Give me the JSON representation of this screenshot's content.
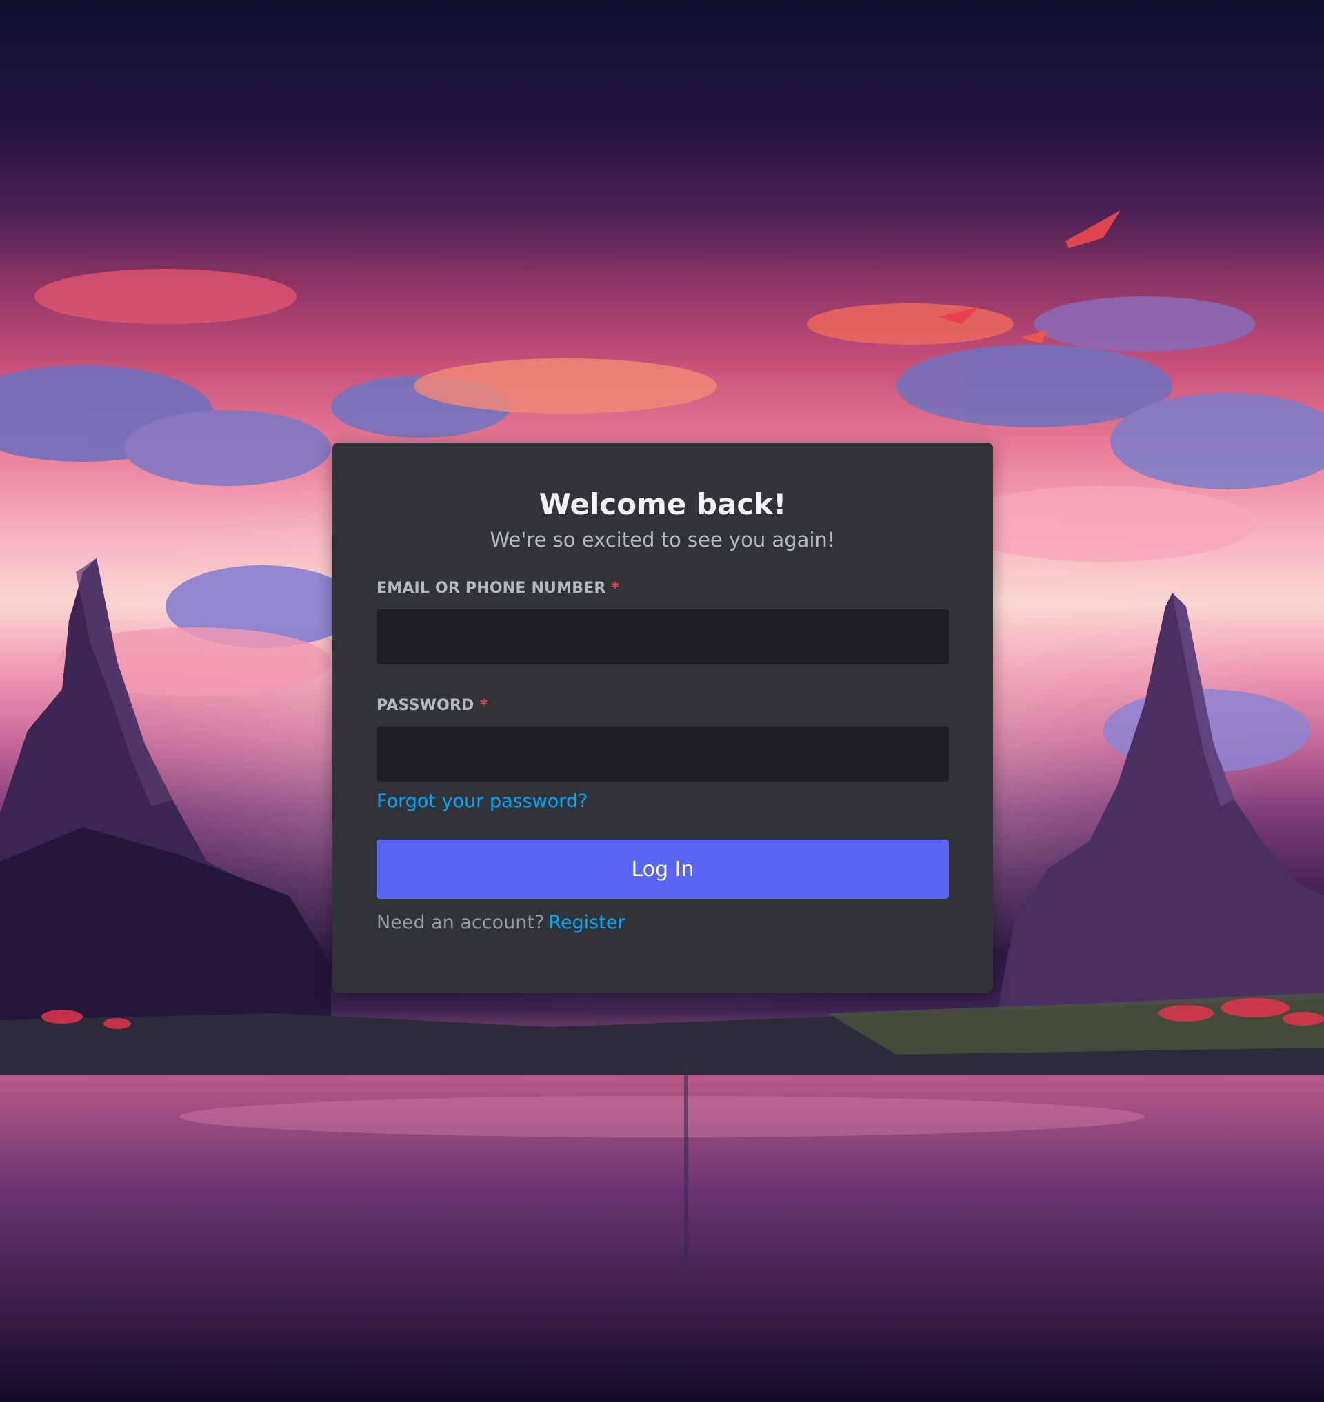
{
  "login": {
    "title": "Welcome back!",
    "subtitle": "We're so excited to see you again!",
    "email_label": "EMAIL OR PHONE NUMBER",
    "email_value": "",
    "password_label": "PASSWORD",
    "password_value": "",
    "required_marker": "*",
    "forgot_link": "Forgot your password?",
    "login_button": "Log In",
    "need_account": "Need an account?",
    "register_link": "Register"
  },
  "colors": {
    "card_background": "#313338",
    "input_background": "#1e1f22",
    "button_blurple": "#5865f2",
    "link_blue": "#00a8fc",
    "required_red": "#f23f43",
    "heading": "#f2f3f5",
    "muted_text": "#b5bac1"
  },
  "icons": {
    "background": "purple-sunset-landscape-illustration"
  }
}
